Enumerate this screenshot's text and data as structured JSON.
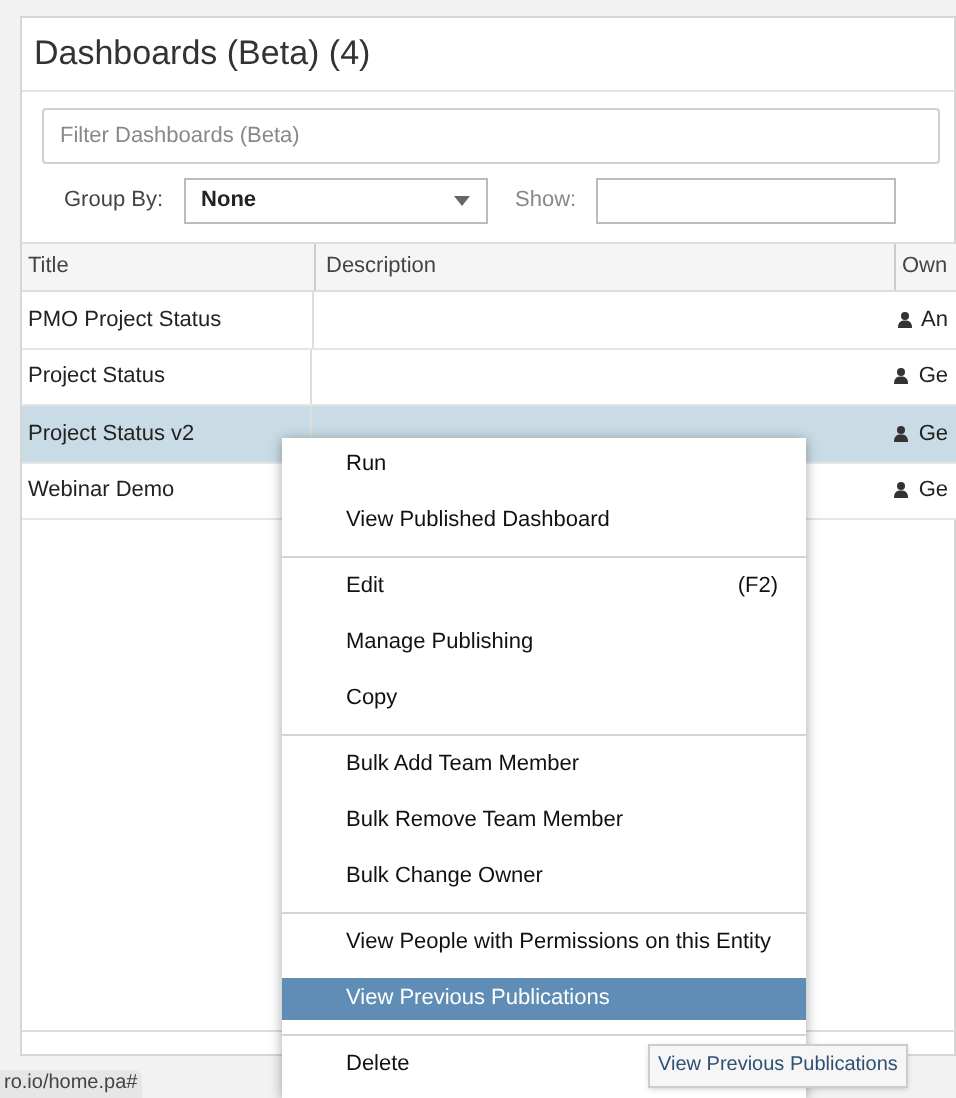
{
  "panel": {
    "title": "Dashboards (Beta) (4)"
  },
  "filter": {
    "placeholder": "Filter Dashboards (Beta)"
  },
  "group_by": {
    "label": "Group By:",
    "value": "None"
  },
  "show": {
    "label": "Show:"
  },
  "table": {
    "columns": [
      "Title",
      "Description",
      "Own"
    ],
    "rows": [
      {
        "title": "PMO Project Status",
        "owner": "An",
        "selected": false
      },
      {
        "title": "Project Status",
        "owner": "Ge",
        "selected": false
      },
      {
        "title": "Project Status v2",
        "owner": "Ge",
        "selected": true
      },
      {
        "title": "Webinar Demo",
        "owner": "Ge",
        "selected": false
      }
    ]
  },
  "context_menu": [
    {
      "kind": "item",
      "label": "Run",
      "selected": false
    },
    {
      "kind": "item",
      "label": "View Published Dashboard",
      "selected": false
    },
    {
      "kind": "divider"
    },
    {
      "kind": "item",
      "label": "Edit",
      "shortcut": "(F2)",
      "selected": false
    },
    {
      "kind": "item",
      "label": "Manage Publishing",
      "selected": false
    },
    {
      "kind": "item",
      "label": "Copy",
      "selected": false
    },
    {
      "kind": "divider"
    },
    {
      "kind": "item",
      "label": "Bulk Add Team Member",
      "selected": false
    },
    {
      "kind": "item",
      "label": "Bulk Remove Team Member",
      "selected": false
    },
    {
      "kind": "item",
      "label": "Bulk Change Owner",
      "selected": false
    },
    {
      "kind": "divider"
    },
    {
      "kind": "item",
      "label": "View People with Permissions on this Entity",
      "selected": false
    },
    {
      "kind": "item",
      "label": "View Previous Publications",
      "selected": true
    },
    {
      "kind": "divider"
    },
    {
      "kind": "item",
      "label": "Delete",
      "selected": false
    }
  ],
  "tooltip": "View Previous Publications",
  "status_url": "ro.io/home.pa#"
}
